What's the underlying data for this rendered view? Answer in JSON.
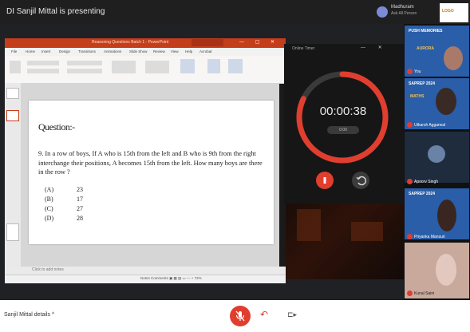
{
  "meeting": {
    "title": "DI Sanjil Mittal is presenting",
    "user_name": "Madhuram",
    "user_status": "Ask All Person",
    "logo": "LOGO"
  },
  "ppt": {
    "filename": "Reasoning Questions Batch 1 - PowerPoint",
    "tabs": [
      "File",
      "Home",
      "Insert",
      "Design",
      "Transitions",
      "Animations",
      "Slide Show",
      "Review",
      "View",
      "Help",
      "Acrobat"
    ],
    "notes": "Click to add notes",
    "zoom": "Notes  Comments   ▣  ▦  ▤  ▭   —  +  72%"
  },
  "slide": {
    "heading": "Question:-",
    "question": "9. In a row of boys, If A who is 15th from the left and B who is 9th from the right interchange their positions, A becomes 15th from the left. How many boys are there in the row ?",
    "options": [
      {
        "key": "(A)",
        "value": "23"
      },
      {
        "key": "(B)",
        "value": "17"
      },
      {
        "key": "(C)",
        "value": "27"
      },
      {
        "key": "(D)",
        "value": "28"
      }
    ]
  },
  "timer": {
    "title": "Online Timer",
    "value": "00:00:38",
    "sub": "0:00",
    "progress": 0.82,
    "accent": "#e03e2f"
  },
  "participants": [
    {
      "name": "You",
      "banner": "PUSH MEMORIES",
      "banner2": "AURORA",
      "bg": "#2a5ea8"
    },
    {
      "name": "Utkarsh Aggarwal",
      "banner": "SAPREP 2024",
      "banner2": "MATHS",
      "bg": "#2a5ea8"
    },
    {
      "name": "Apoorv Singh",
      "banner": "",
      "banner2": "",
      "bg": "#1e2c3e"
    },
    {
      "name": "Priyanka Mansuri",
      "banner": "SAPREP 2024",
      "banner2": "",
      "bg": "#2a5ea8"
    },
    {
      "name": "Kunal Saini",
      "banner": "",
      "banner2": "",
      "bg": "#c9a99c"
    }
  ],
  "bottom": {
    "left": "Sanjil Mittal details ^"
  }
}
